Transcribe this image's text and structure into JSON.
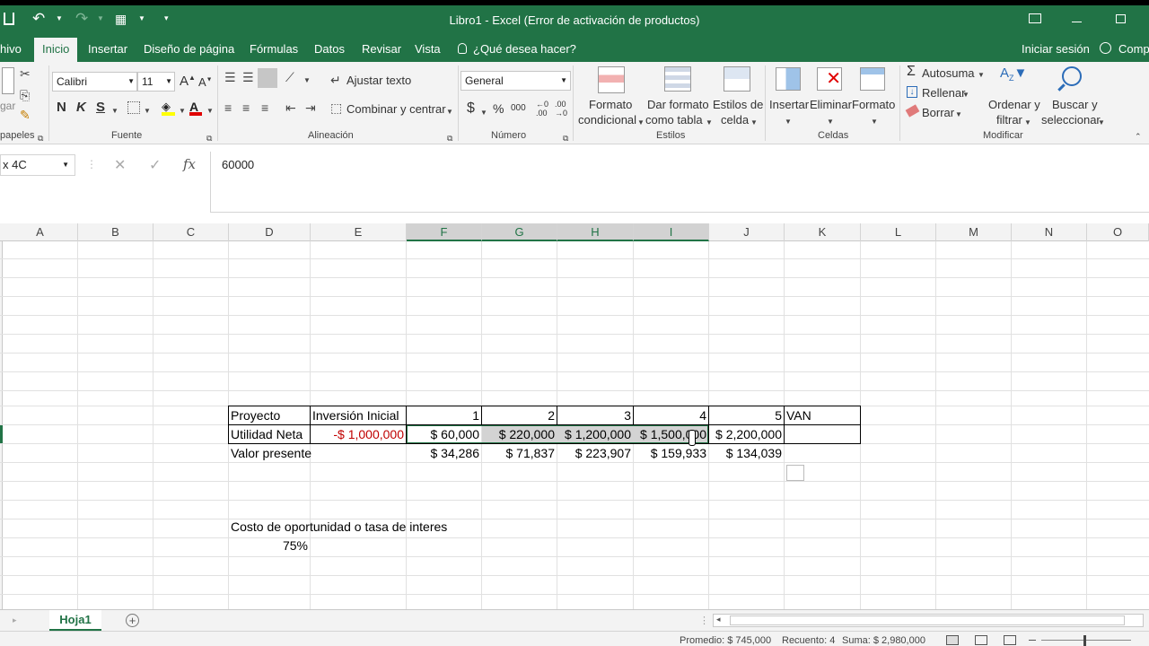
{
  "window": {
    "title": "Libro1 - Excel (Error de activación de productos)"
  },
  "tabs": {
    "archivo": "hivo",
    "inicio": "Inicio",
    "insertar": "Insertar",
    "diseno": "Diseño de página",
    "formulas": "Fórmulas",
    "datos": "Datos",
    "revisar": "Revisar",
    "vista": "Vista",
    "tell_me": "¿Qué desea hacer?",
    "sign_in": "Iniciar sesión",
    "share": "Comp"
  },
  "ribbon": {
    "clipboard_paste": "gar",
    "clipboard_label": "papeles",
    "font_name": "Calibri",
    "font_size": "11",
    "font_label": "Fuente",
    "bold": "N",
    "italic": "K",
    "underline": "S",
    "wrap_text": "Ajustar texto",
    "merge_center": "Combinar y centrar",
    "alignment_label": "Alineación",
    "number_format": "General",
    "number_label": "Número",
    "cond_format_1": "Formato",
    "cond_format_2": "condicional",
    "table_format_1": "Dar formato",
    "table_format_2": "como tabla",
    "cell_styles_1": "Estilos de",
    "cell_styles_2": "celda",
    "styles_label": "Estilos",
    "insert": "Insertar",
    "delete": "Eliminar",
    "format": "Formato",
    "cells_label": "Celdas",
    "autosum": "Autosuma",
    "fill": "Rellenar",
    "clear": "Borrar",
    "sort_1": "Ordenar y",
    "sort_2": "filtrar",
    "find_1": "Buscar y",
    "find_2": "seleccionar",
    "editing_label": "Modificar"
  },
  "formula_bar": {
    "name_box": "x 4C",
    "formula": "60000"
  },
  "columns": [
    "A",
    "B",
    "C",
    "D",
    "E",
    "F",
    "G",
    "H",
    "I",
    "J",
    "K",
    "L",
    "M",
    "N",
    "O"
  ],
  "sheet": {
    "header": {
      "d": "Proyecto",
      "e": "Inversión Inicial",
      "f": "1",
      "g": "2",
      "h": "3",
      "i": "4",
      "j": "5",
      "k": "VAN"
    },
    "utilidad": {
      "d": "Utilidad Neta",
      "e": "-$ 1,000,000",
      "f": "$ 60,000",
      "g": "$ 220,000",
      "h": "$ 1,200,000",
      "i": "$ 1,500,000",
      "j": "$ 2,200,000"
    },
    "valor": {
      "d": "Valor presente",
      "f": "$ 34,286",
      "g": "$ 71,837",
      "h": "$ 223,907",
      "i": "$ 159,933",
      "j": "$ 134,039"
    },
    "costo_label": "Costo de oportunidad o tasa de interes",
    "rate": "75%"
  },
  "sheet_tab": "Hoja1",
  "status": {
    "promedio": "Promedio: $ 745,000",
    "recuento": "Recuento: 4",
    "suma": "Suma: $ 2,980,000"
  },
  "colors": {
    "excel_green": "#217346",
    "negative": "#c00000"
  }
}
